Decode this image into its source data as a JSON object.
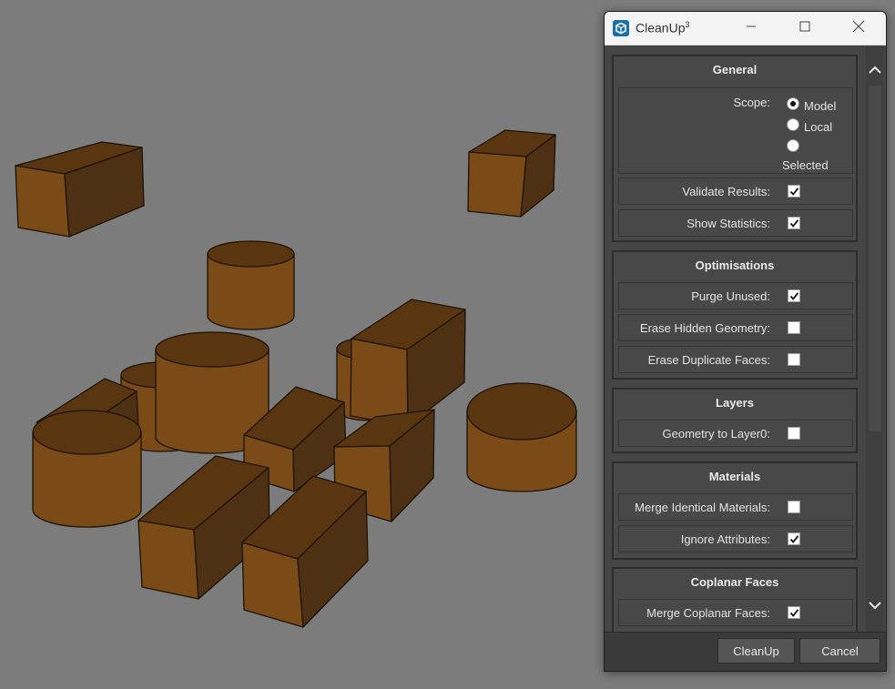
{
  "window": {
    "title": "CleanUp",
    "title_superscript": "3",
    "icon": "sketchup-icon"
  },
  "window_controls": {
    "minimize_icon": "minimize-icon",
    "maximize_icon": "maximize-icon",
    "close_icon": "close-icon"
  },
  "groups": {
    "general": {
      "title": "General",
      "scope_label": "Scope:",
      "scope_options": [
        "Model",
        "Local",
        "Selected"
      ],
      "scope_selected": "Model",
      "validate_results": {
        "label": "Validate Results:",
        "checked": true
      },
      "show_statistics": {
        "label": "Show Statistics:",
        "checked": true
      }
    },
    "optimisations": {
      "title": "Optimisations",
      "purge_unused": {
        "label": "Purge Unused:",
        "checked": true
      },
      "erase_hidden_geometry": {
        "label": "Erase Hidden Geometry:",
        "checked": false
      },
      "erase_duplicate_faces": {
        "label": "Erase Duplicate Faces:",
        "checked": false
      }
    },
    "layers": {
      "title": "Layers",
      "geometry_to_layer0": {
        "label": "Geometry to Layer0:",
        "checked": false
      }
    },
    "materials": {
      "title": "Materials",
      "merge_identical_materials": {
        "label": "Merge Identical Materials:",
        "checked": false
      },
      "ignore_attributes": {
        "label": "Ignore Attributes:",
        "checked": true
      }
    },
    "coplanar_faces": {
      "title": "Coplanar Faces",
      "merge_coplanar_faces": {
        "label": "Merge Coplanar Faces:",
        "checked": true
      }
    }
  },
  "buttons": {
    "cleanup": "CleanUp",
    "cancel": "Cancel"
  },
  "colors": {
    "viewport_background": "#7c7c7c",
    "object_face": "#7a4a17",
    "object_side": "#4e3012",
    "object_top": "#5a3610",
    "dialog_background": "#454545",
    "group_background": "#484848"
  }
}
